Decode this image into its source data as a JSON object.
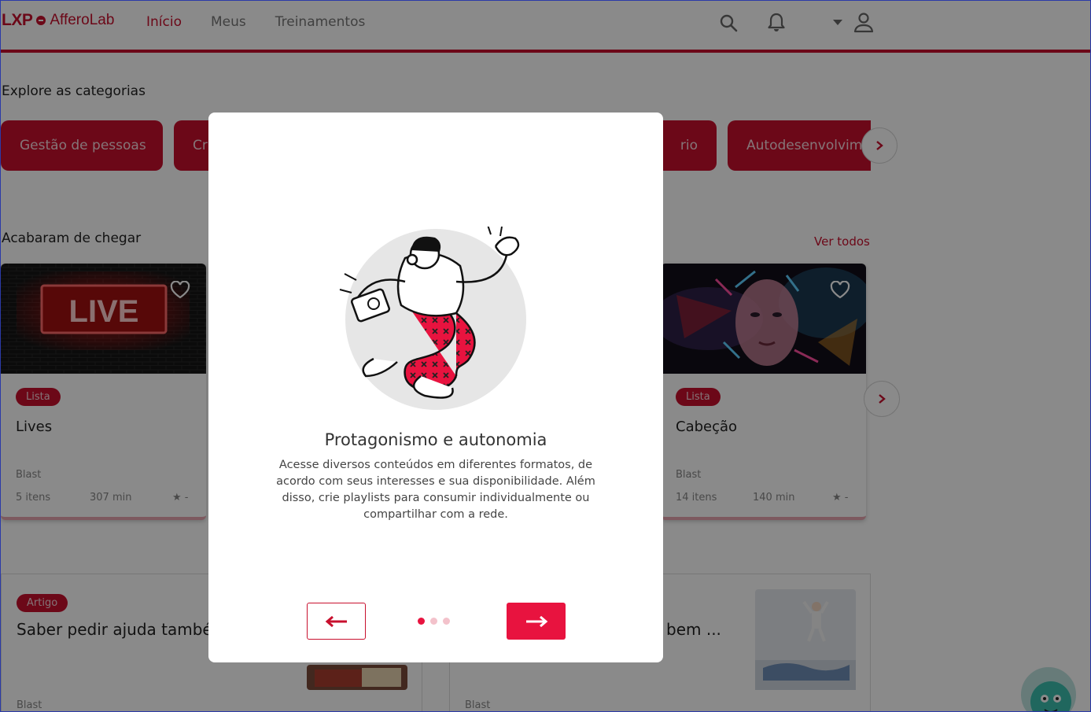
{
  "header": {
    "logo_primary": "LXP",
    "logo_brand": "AfferoLab",
    "nav": [
      "Início",
      "Meus",
      "Treinamentos"
    ]
  },
  "categories": {
    "title": "Explore as categorias",
    "items": [
      "Gestão de pessoas",
      "Cr",
      "rio",
      "Autodesenvolvim"
    ]
  },
  "recent": {
    "title": "Acabaram de chegar",
    "see_all": "Ver todos",
    "cards": [
      {
        "badge": "Lista",
        "title": "Lives",
        "type": "Blast",
        "items": "5 itens",
        "duration": "307 min",
        "rating": "★ -",
        "image_text": "LIVE"
      },
      {
        "badge": "Lista",
        "title": "Cabeção",
        "type": "Blast",
        "items": "14 itens",
        "duration": "140 min",
        "rating": "★ -"
      }
    ]
  },
  "articles": [
    {
      "badge": "Artigo",
      "title": "Saber pedir ajuda também",
      "type": "Blast"
    },
    {
      "title": "bem ...",
      "type": "Blast"
    }
  ],
  "modal": {
    "title": "Protagonismo e autonomia",
    "text": "Acesse diversos conteúdos em diferentes formatos, de acordo com seus interesses e sua disponibilidade. Além disso, crie playlists para consumir individualmente ou compartilhar com a rede.",
    "pagination": {
      "current": 1,
      "total": 3
    }
  },
  "colors": {
    "brand": "#c8102e",
    "accent": "#e8133f"
  }
}
